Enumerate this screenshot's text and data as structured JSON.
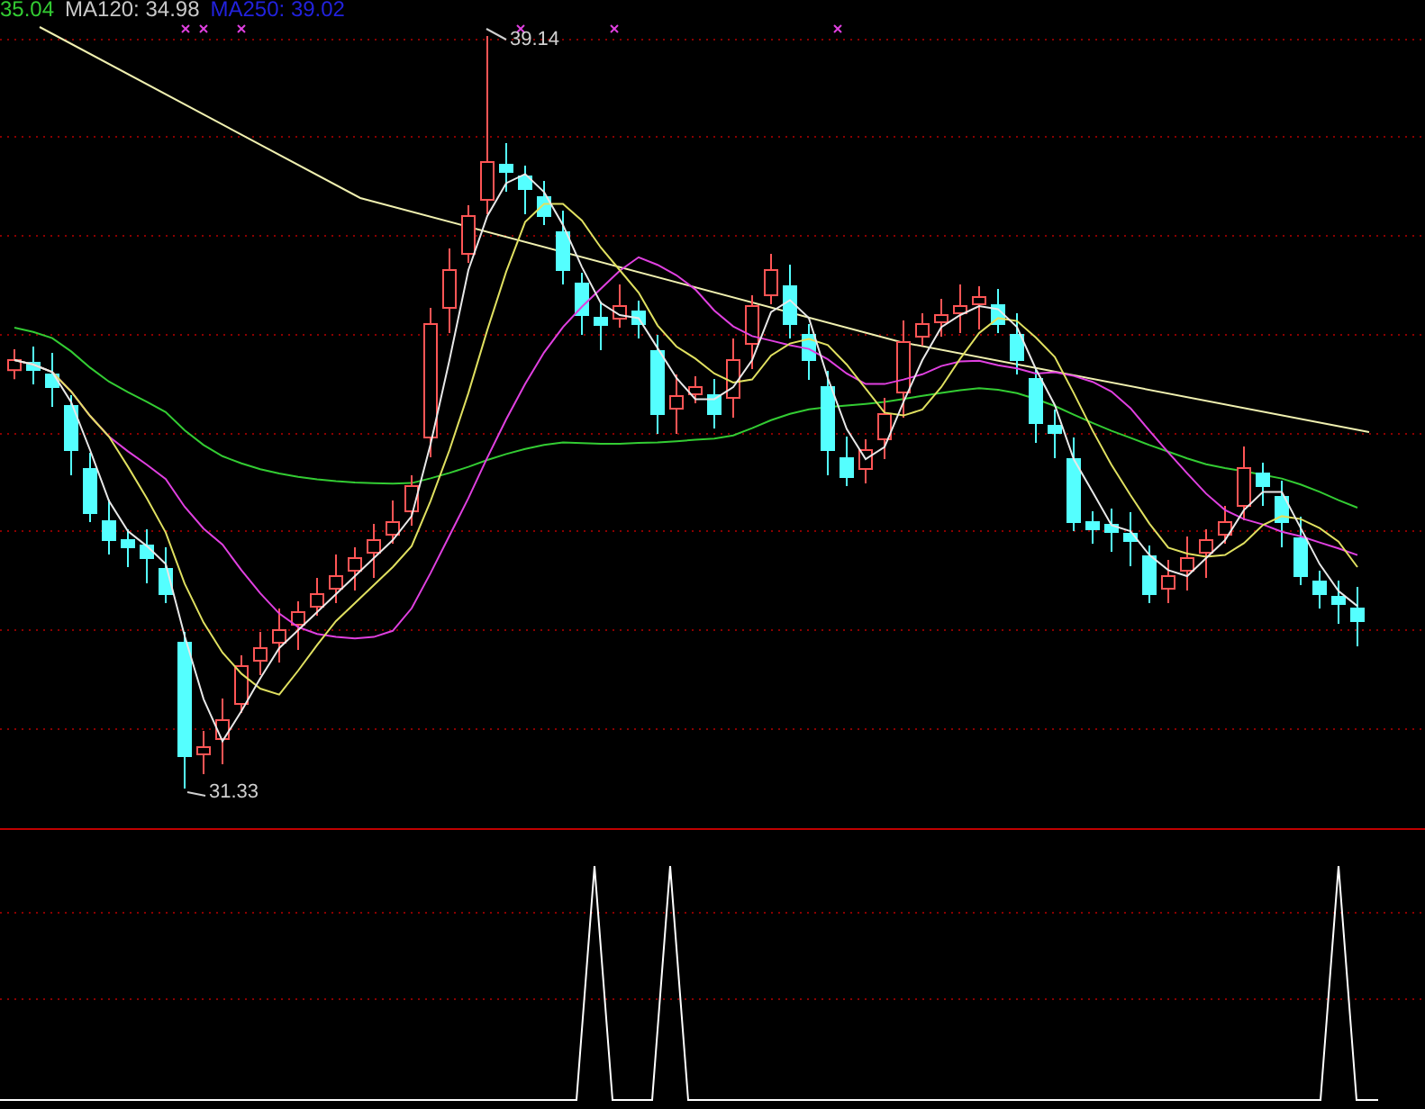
{
  "legend": [
    {
      "text": "35.04",
      "color": "#33cc33"
    },
    {
      "text": "MA120: 34.98",
      "color": "#c8c8c8"
    },
    {
      "text": "MA250: 39.02",
      "color": "#2222dd"
    }
  ],
  "price_labels": [
    {
      "text": "39.14",
      "kind": "high"
    },
    {
      "text": "31.33",
      "kind": "low"
    }
  ]
}
